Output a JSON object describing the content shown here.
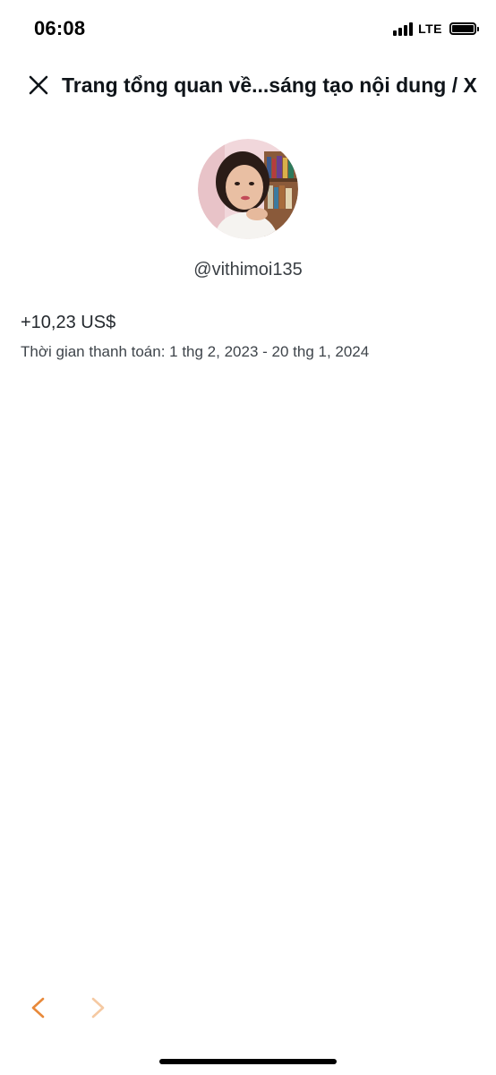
{
  "status_bar": {
    "time": "06:08",
    "network": "LTE",
    "signal_icon": "signal-bars-icon",
    "battery_icon": "battery-icon"
  },
  "header": {
    "close_icon": "close-icon",
    "title": "Trang tổng quan về...sáng tạo nội dung / X"
  },
  "profile": {
    "avatar": "avatar-photo",
    "username": "@vithimoi135"
  },
  "earnings": {
    "amount": "+10,23 US$",
    "period": "Thời gian thanh toán: 1 thg 2, 2023 - 20 thg 1, 2024"
  },
  "bottom_nav": {
    "back_icon": "chevron-left-icon",
    "forward_icon": "chevron-right-icon",
    "accent_color": "#e8893a",
    "disabled_color": "#f5c9a2"
  }
}
